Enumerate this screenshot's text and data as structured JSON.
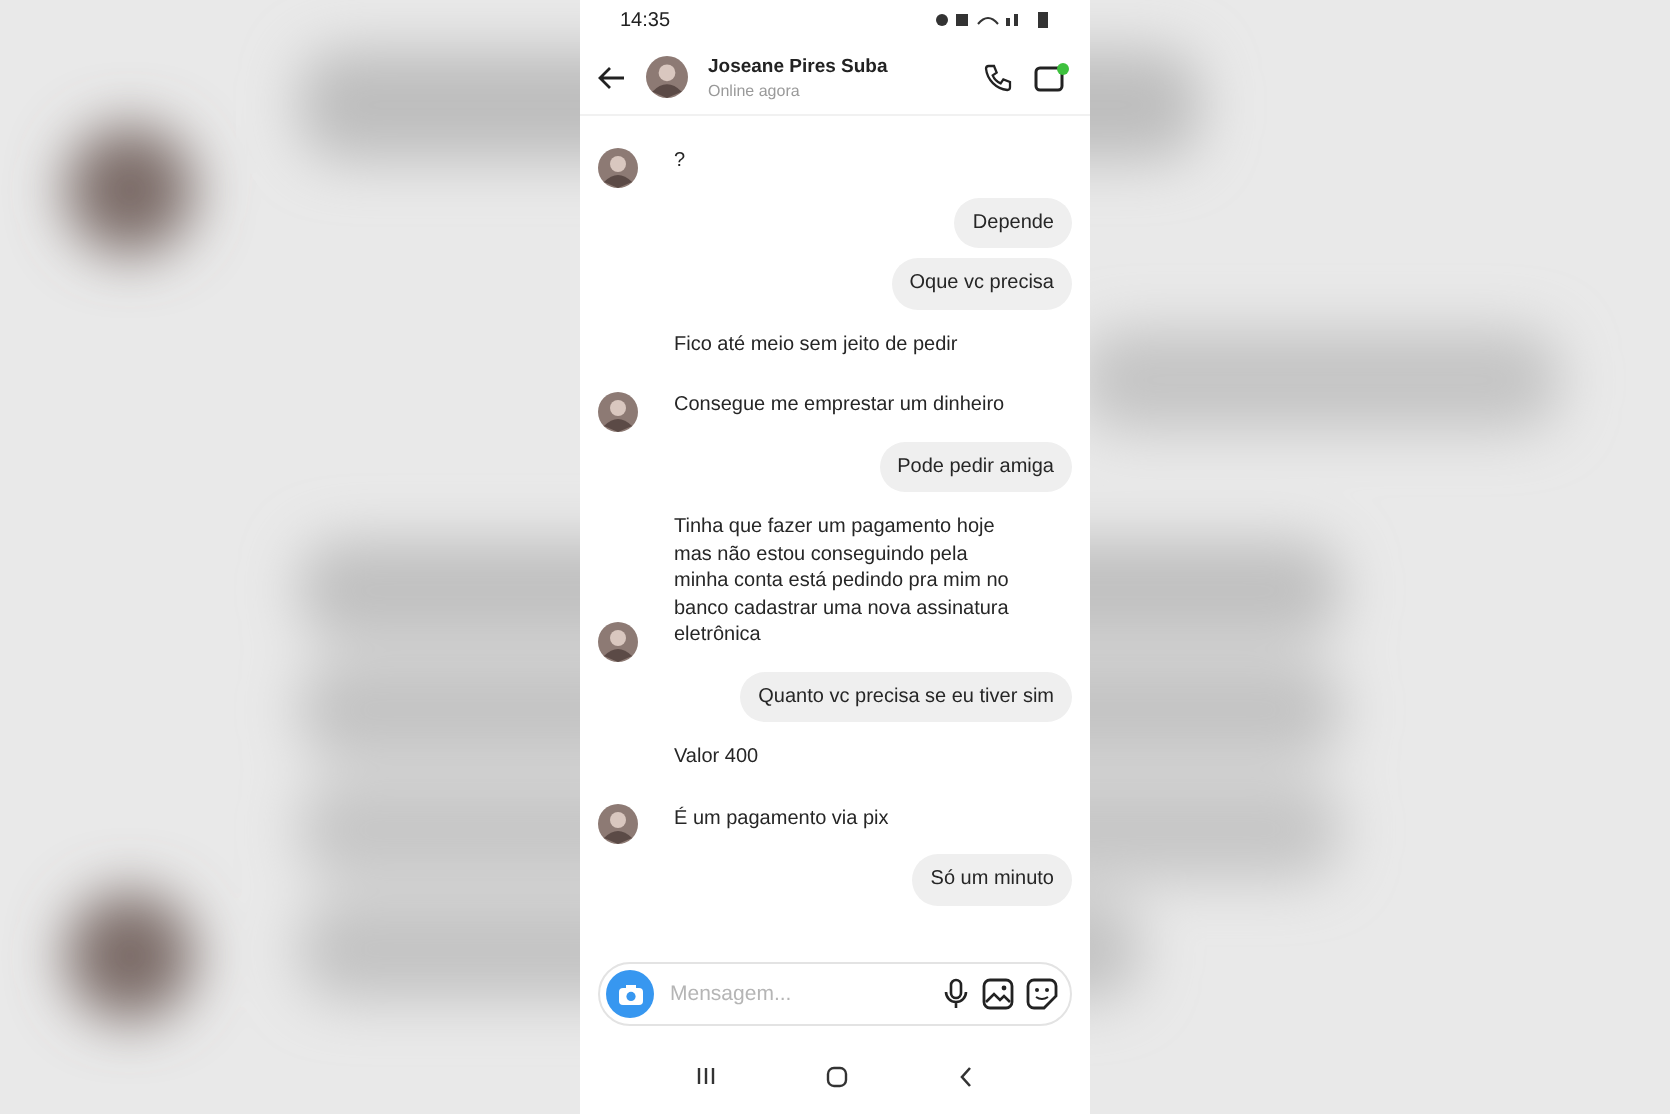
{
  "status_bar": {
    "time": "14:35"
  },
  "header": {
    "name": "Joseane Pires Suba",
    "status": "Online agora",
    "video_active": true
  },
  "messages": [
    {
      "kind": "in",
      "text": "?",
      "avatar": true
    },
    {
      "kind": "out",
      "text": "Depende"
    },
    {
      "kind": "out",
      "text": "Oque vc precisa"
    },
    {
      "kind": "in",
      "text": "Fico até meio sem jeito de pedir",
      "avatar": false
    },
    {
      "kind": "in",
      "text": "Consegue me emprestar um dinheiro",
      "avatar": true
    },
    {
      "kind": "out",
      "text": "Pode pedir amiga"
    },
    {
      "kind": "in",
      "text": "Tinha que fazer um pagamento hoje mas não estou conseguindo pela minha conta está pedindo pra mim no banco cadastrar uma nova assinatura eletrônica",
      "avatar": true
    },
    {
      "kind": "out",
      "text": "Quanto vc precisa se eu tiver sim"
    },
    {
      "kind": "in",
      "text": "Valor 400",
      "avatar": false
    },
    {
      "kind": "in",
      "text": "É um pagamento via pix",
      "avatar": true
    },
    {
      "kind": "out",
      "text": "Só um minuto"
    }
  ],
  "composer": {
    "placeholder": "Mensagem..."
  }
}
